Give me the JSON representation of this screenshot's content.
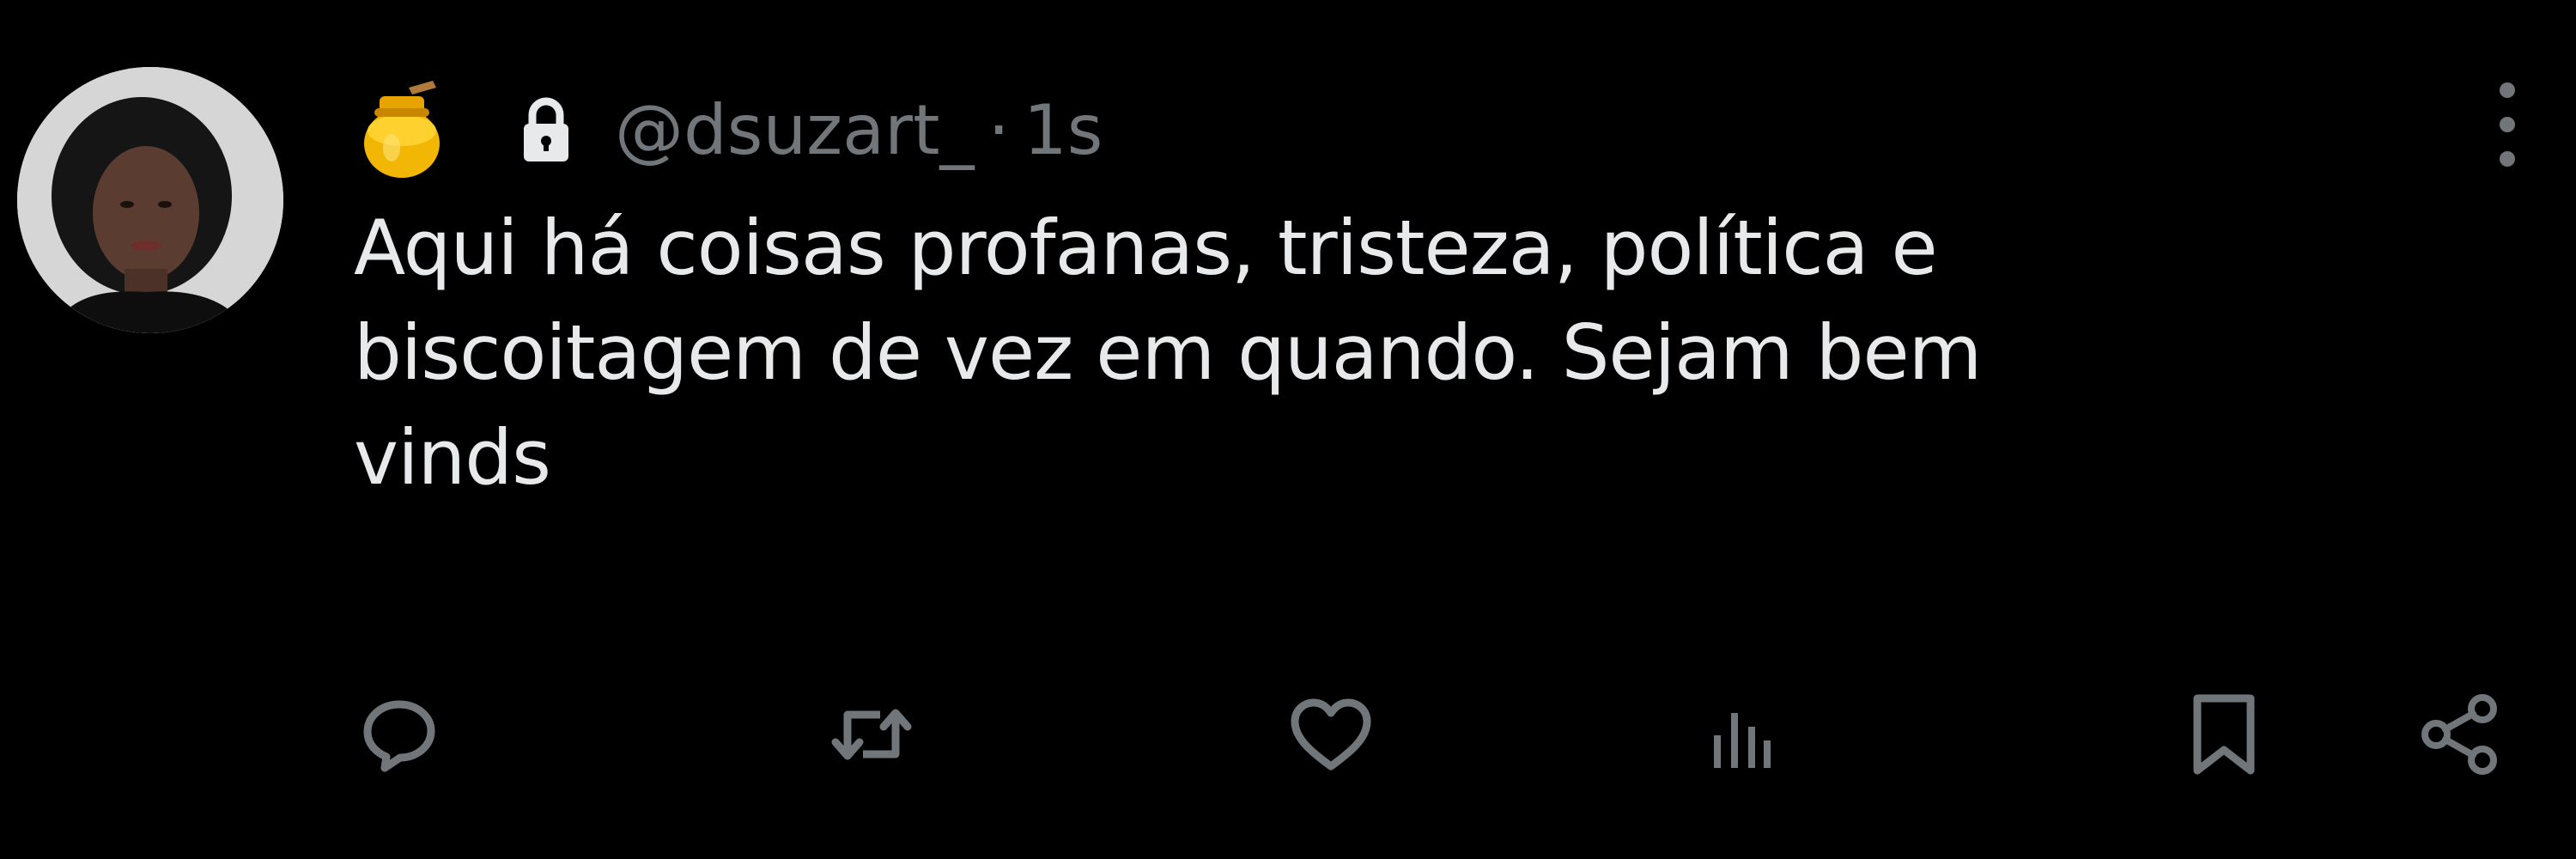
{
  "tweet": {
    "handle": "@dsuzart_",
    "separator": "·",
    "time": "1s",
    "text": "Aqui há coisas profanas, tristeza, política e\nbiscoitagem de vez em quando. Sejam bem\nvinds"
  },
  "icons": {
    "avatar": "avatar",
    "badge": "honey-pot-icon",
    "protected": "lock-icon",
    "more": "more-vertical-icon",
    "actions": [
      "reply-icon",
      "retweet-icon",
      "like-icon",
      "views-icon",
      "bookmark-icon",
      "share-icon"
    ]
  },
  "colors": {
    "background": "#000000",
    "primary_text": "#e7e9ea",
    "secondary_text": "#71767b",
    "icon": "#71767b"
  }
}
